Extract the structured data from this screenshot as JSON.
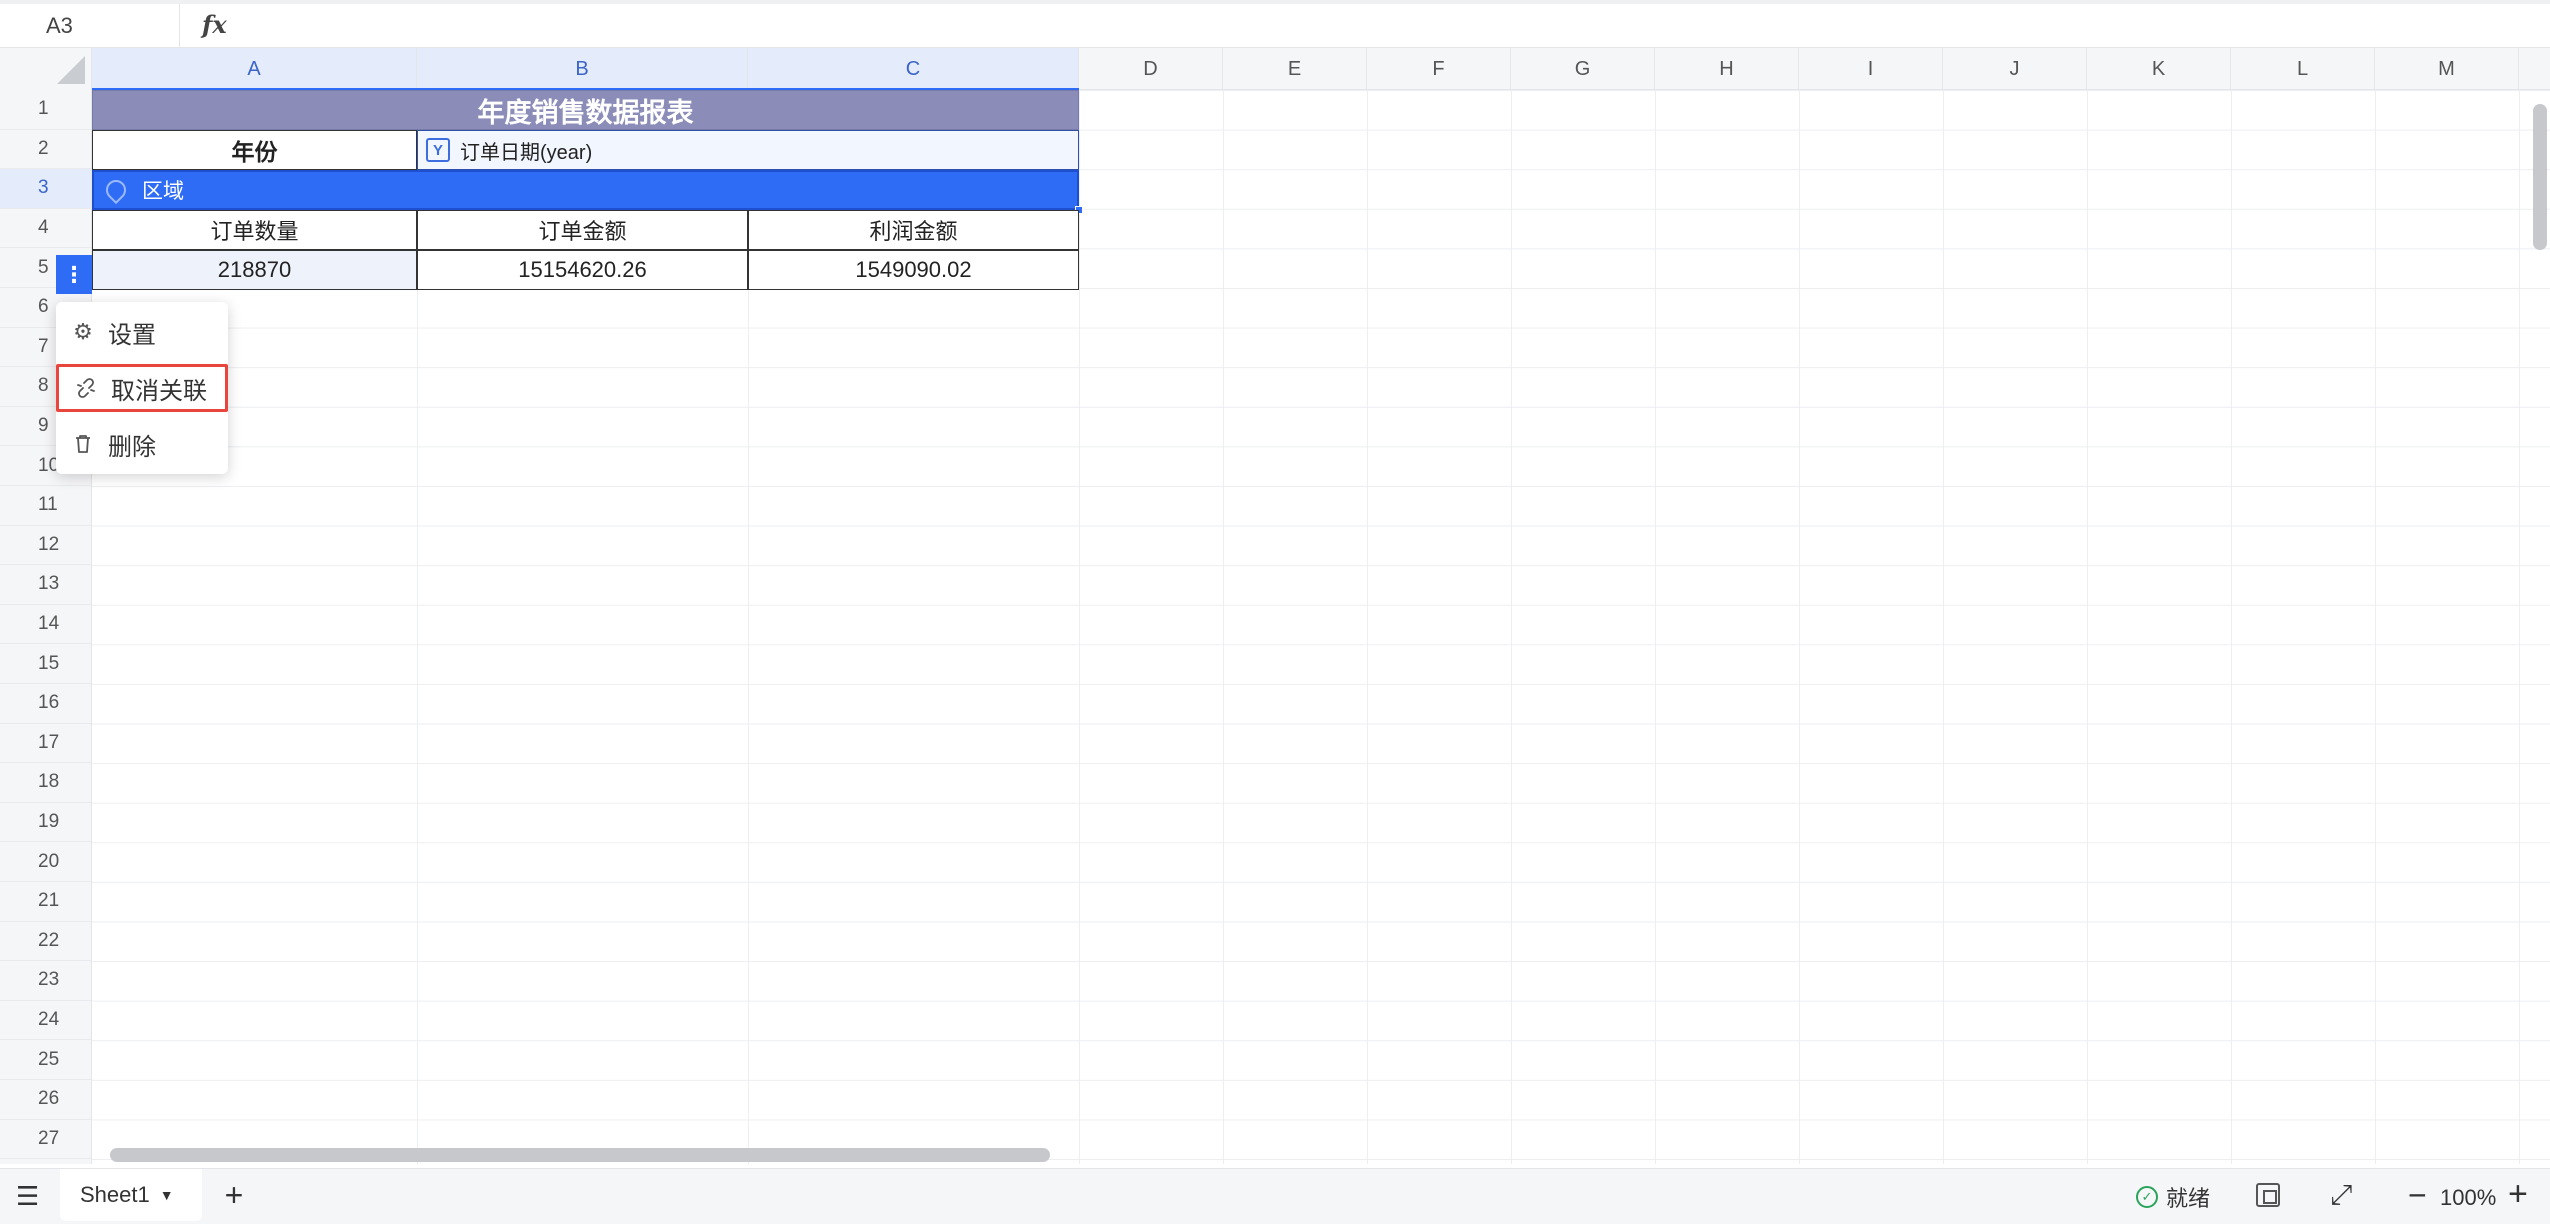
{
  "formula_bar": {
    "cell_ref": "A3",
    "fx_label": "fx",
    "value": ""
  },
  "columns": [
    "A",
    "B",
    "C",
    "D",
    "E",
    "F",
    "G",
    "H",
    "I",
    "J",
    "K",
    "L",
    "M"
  ],
  "rows": [
    "1",
    "2",
    "3",
    "4",
    "5",
    "6",
    "7",
    "8",
    "9",
    "10",
    "11",
    "12",
    "13",
    "14",
    "15",
    "16",
    "17",
    "18",
    "19",
    "20",
    "21",
    "22",
    "23",
    "24",
    "25",
    "26",
    "27"
  ],
  "report": {
    "title": "年度销售数据报表",
    "year_label": "年份",
    "date_field": "订单日期(year)",
    "date_field_icon": "Y",
    "region_field": "区域",
    "headers": {
      "count": "订单数量",
      "amount": "订单金额",
      "profit": "利润金额"
    },
    "values": {
      "count": "218870",
      "amount": "15154620.26",
      "profit": "1549090.02"
    }
  },
  "row_handle": "⋮",
  "context_menu": {
    "settings": "设置",
    "unlink": "取消关联",
    "delete": "删除"
  },
  "bottom": {
    "sheet_name": "Sheet1",
    "status": "就绪",
    "zoom": "100%"
  },
  "colors": {
    "accent": "#2f6cf6",
    "title_bg": "#8b8db8",
    "highlight": "#e8453c"
  }
}
